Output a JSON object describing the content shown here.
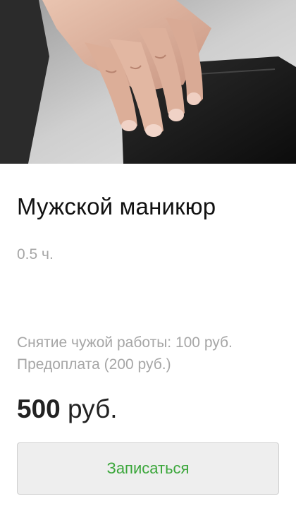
{
  "service": {
    "image_alt": "hand-holding-wallet-photo",
    "title": "Мужской маникюр",
    "duration": "0.5 ч.",
    "notes": [
      "Снятие чужой работы: 100 руб.",
      "Предоплата (200 руб.)"
    ],
    "price": {
      "amount": "500",
      "currency": "руб."
    },
    "book_button_label": "Записаться"
  },
  "colors": {
    "accent_green": "#3aa63a",
    "muted_text": "#a6a6a6",
    "button_bg": "#eeeeee"
  }
}
